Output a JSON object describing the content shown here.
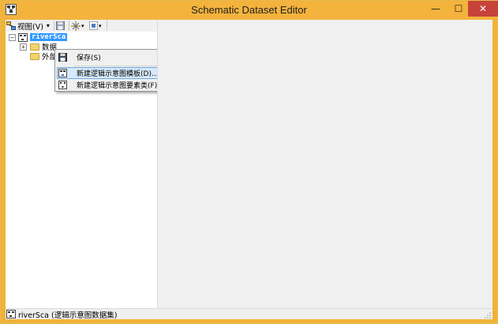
{
  "window": {
    "title": "Schematic Dataset Editor",
    "minimize_glyph": "—",
    "maximize_glyph": "☐",
    "close_glyph": "✕"
  },
  "toolbar": {
    "view_label": "视图(V)",
    "view_dropdown_glyph": "▾",
    "icons": [
      "view-icon",
      "save-icon",
      "expand-all-icon",
      "layout-icon"
    ]
  },
  "tree": {
    "root_label": "riverSca",
    "children": [
      {
        "label": "数据",
        "expander": "+"
      },
      {
        "label": "外部"
      }
    ],
    "root_expander": "−"
  },
  "context_menu": {
    "items": [
      {
        "label": "保存(S)",
        "icon": "save-icon"
      },
      {
        "label": "新建逻辑示意图模板(D)...",
        "icon": "template-icon",
        "highlighted": true
      },
      {
        "label": "新建逻辑示意图要素类(F)...",
        "icon": "feature-class-icon"
      }
    ]
  },
  "status": {
    "text": "riverSca (逻辑示意图数据集)"
  },
  "colors": {
    "titlebar": "#f4b33c",
    "close_button": "#c7433a",
    "selection": "#3399ff",
    "menu_highlight": "#d7e9fa"
  }
}
